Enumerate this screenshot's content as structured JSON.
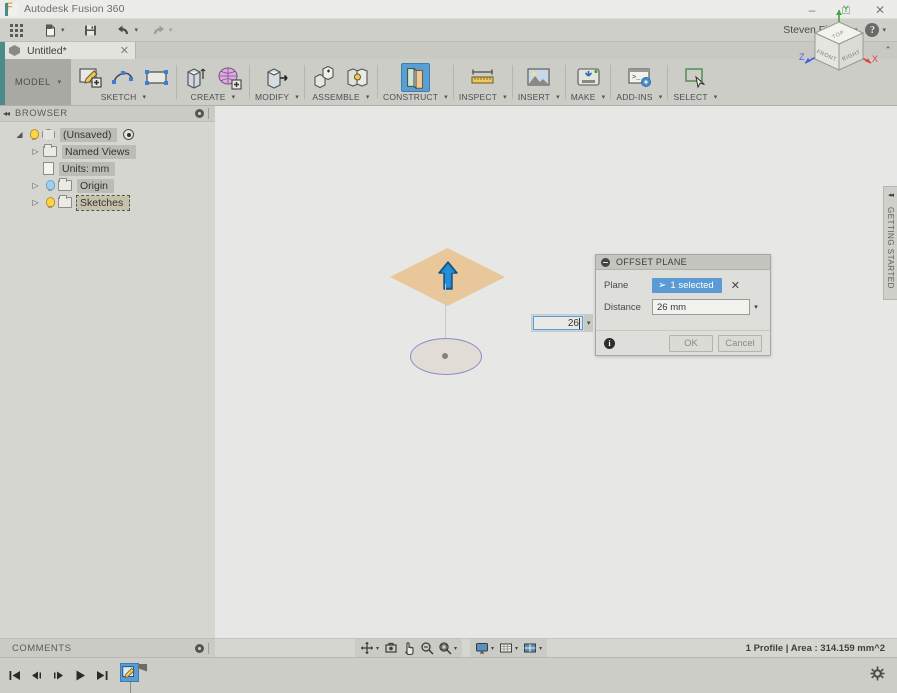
{
  "window": {
    "app_title": "Autodesk Fusion 360",
    "logo_letter": "F",
    "minimize": "–",
    "maximize": "□",
    "close": "✕"
  },
  "quick_access": {
    "grid_icon": "app-grid-icon",
    "new_file_icon": "new-file-icon",
    "save_icon": "save-icon",
    "undo_icon": "undo-icon",
    "redo_icon": "redo-icon",
    "caret": "▾",
    "user_name": "Steven Fisher",
    "user_caret": "▾",
    "help_icon": "?",
    "help_caret": "▾"
  },
  "tabs": {
    "document": {
      "label": "Untitled*",
      "close": "✕",
      "icon": "cube-icon"
    },
    "collapse_caret": "⌃"
  },
  "ribbon": {
    "workspace": {
      "label": "MODEL",
      "caret": "▾"
    },
    "groups": [
      {
        "label": "SKETCH",
        "caret": "▾",
        "icons": [
          "create-sketch-icon",
          "spline-icon",
          "rectangle-icon"
        ]
      },
      {
        "label": "CREATE",
        "caret": "▾",
        "icons": [
          "extrude-icon",
          "mesh-create-icon"
        ]
      },
      {
        "label": "MODIFY",
        "caret": "▾",
        "icons": [
          "press-pull-icon"
        ]
      },
      {
        "label": "ASSEMBLE",
        "caret": "▾",
        "icons": [
          "new-component-icon",
          "joint-icon"
        ]
      },
      {
        "label": "CONSTRUCT",
        "caret": "▾",
        "icons": [
          "offset-plane-icon"
        ]
      },
      {
        "label": "INSPECT",
        "caret": "▾",
        "icons": [
          "measure-icon"
        ]
      },
      {
        "label": "INSERT",
        "caret": "▾",
        "icons": [
          "insert-image-icon"
        ]
      },
      {
        "label": "MAKE",
        "caret": "▾",
        "icons": [
          "3d-print-icon"
        ]
      },
      {
        "label": "ADD-INS",
        "caret": "▾",
        "icons": [
          "scripts-addins-icon"
        ]
      },
      {
        "label": "SELECT",
        "caret": "▾",
        "icons": [
          "select-window-icon"
        ]
      }
    ]
  },
  "browser": {
    "title": "BROWSER",
    "collapse_icon": "◂◂",
    "settings_icon": "browser-settings-icon",
    "tree": [
      {
        "label": "(Unsaved)",
        "twisty": "◢",
        "icon": "cube-icon",
        "indent": 0,
        "state": "highlighted",
        "has_bulb": true,
        "bulb": "on",
        "trailing": "radio-icon"
      },
      {
        "label": "Named Views",
        "twisty": "▷",
        "icon": "folder-icon",
        "indent": 1,
        "state": "highlighted",
        "has_bulb": false
      },
      {
        "label": "Units: mm",
        "twisty": "",
        "icon": "document-icon",
        "indent": 1,
        "state": "highlighted",
        "has_bulb": false
      },
      {
        "label": "Origin",
        "twisty": "▷",
        "icon": "folder-icon",
        "indent": 1,
        "state": "highlighted",
        "has_bulb": true,
        "bulb": "blue"
      },
      {
        "label": "Sketches",
        "twisty": "▷",
        "icon": "folder-icon",
        "indent": 1,
        "state": "selected",
        "has_bulb": true,
        "bulb": "on"
      }
    ]
  },
  "canvas": {
    "plane_color": "#e8c89a",
    "arrow_color": "#1d7ec4",
    "sketch_circle_color": "#8c8cc8",
    "background_color": "#e7e7e5",
    "inline_value": {
      "value": "26",
      "dropdown_caret": "▾"
    },
    "viewcube": {
      "top_face": "TOP",
      "front_face": "FRONT",
      "right_face": "RIGHT",
      "axis_x": "X",
      "axis_y": "Y",
      "axis_z": "Z",
      "axis_x_color": "#e04040",
      "axis_y_color": "#3aa83a",
      "axis_z_color": "#4060e0"
    }
  },
  "dialog": {
    "title": "OFFSET PLANE",
    "menu_icon": "dialog-menu-icon",
    "rows": [
      {
        "label": "Plane",
        "selection_text": "1 selected",
        "clear_icon": "✕"
      },
      {
        "label": "Distance",
        "value": "26 mm",
        "dropdown_caret": "▾"
      }
    ],
    "info_icon": "i",
    "ok_label": "OK",
    "cancel_label": "Cancel"
  },
  "getting_started": {
    "label": "GETTING STARTED",
    "collapse_icon": "◂◂"
  },
  "comments": {
    "title": "COMMENTS",
    "settings_icon": "comments-settings-icon"
  },
  "statusbar": {
    "nav_tools": [
      {
        "name": "orbit-icon",
        "caret": "▾"
      },
      {
        "name": "look-at-icon",
        "caret": ""
      },
      {
        "name": "pan-icon",
        "caret": ""
      },
      {
        "name": "zoom-icon",
        "caret": ""
      },
      {
        "name": "zoom-window-icon",
        "caret": "▾"
      }
    ],
    "display_tools": [
      {
        "name": "display-settings-icon",
        "caret": "▾"
      },
      {
        "name": "grid-snaps-icon",
        "caret": "▾"
      },
      {
        "name": "viewports-icon",
        "caret": "▾"
      }
    ],
    "status_text": "1 Profile | Area : 314.159 mm^2"
  },
  "timeline": {
    "controls": [
      {
        "name": "go-to-beginning-icon",
        "glyph": "⏮"
      },
      {
        "name": "step-back-icon",
        "glyph": "◀"
      },
      {
        "name": "step-forward-icon",
        "glyph": "▶"
      },
      {
        "name": "play-icon",
        "glyph": "▶"
      },
      {
        "name": "go-to-end-icon",
        "glyph": "⏭"
      }
    ],
    "feature": {
      "name": "sketch-feature-icon"
    },
    "settings_icon": "timeline-settings-icon"
  }
}
